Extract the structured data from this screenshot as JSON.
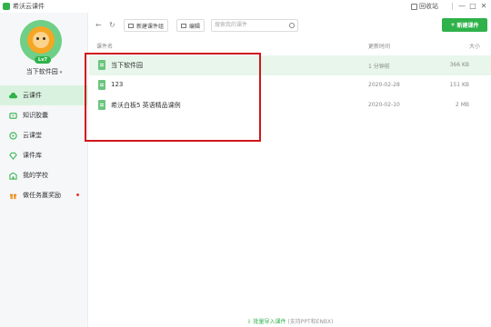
{
  "window": {
    "title": "希沃云课件",
    "recycle_label": "回收站",
    "minimize": "—",
    "maximize": "□",
    "close": "✕"
  },
  "user": {
    "level": "Lv7",
    "name": "当下软件园",
    "caret": "▾"
  },
  "sidebar": {
    "items": [
      {
        "label": "云课件",
        "icon": "cloud-icon",
        "active": true
      },
      {
        "label": "知识胶囊",
        "icon": "capsule-icon"
      },
      {
        "label": "云课堂",
        "icon": "play-circle-icon"
      },
      {
        "label": "课件库",
        "icon": "diamond-icon"
      },
      {
        "label": "我的学校",
        "icon": "school-icon"
      },
      {
        "label": "做任务赢奖励",
        "icon": "gift-icon",
        "dot": true
      }
    ]
  },
  "toolbar": {
    "back": "←",
    "refresh": "↻",
    "new_folder_label": "新建课件组",
    "edit_label": "编辑",
    "search_placeholder": "搜索我的课件",
    "new_courseware_label": "新建课件"
  },
  "list": {
    "headers": {
      "name": "课件名",
      "updated": "更新时间",
      "size": "大小"
    },
    "rows": [
      {
        "name": "当下软件园",
        "updated": "1 分钟前",
        "size": "366 KB"
      },
      {
        "name": "123",
        "updated": "2020-02-28",
        "size": "151 KB"
      },
      {
        "name": "希沃白板5 英语精品课例",
        "updated": "2020-02-10",
        "size": "2 MB"
      }
    ]
  },
  "footer": {
    "import_label": "批量导入课件",
    "import_note": "(支持PPT和ENBX)"
  },
  "colors": {
    "accent": "#2fb24a",
    "selected_row": "#e8f6eb",
    "annotation_box": "#d0161b"
  }
}
